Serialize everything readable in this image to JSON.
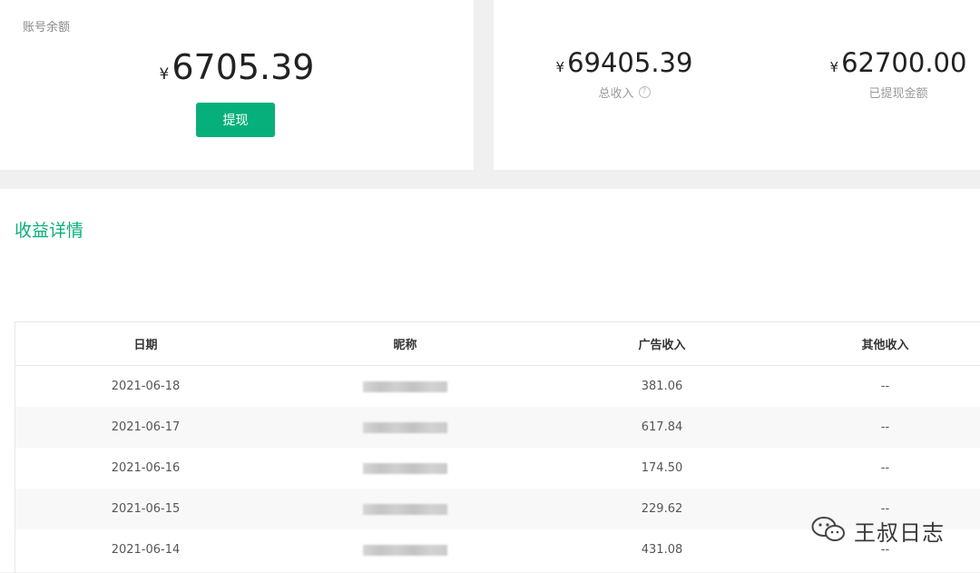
{
  "balance_card": {
    "label": "账号余额",
    "currency": "¥",
    "amount": "6705.39",
    "withdraw_button": "提现"
  },
  "income_card": {
    "total": {
      "currency": "¥",
      "amount": "69405.39",
      "label": "总收入",
      "help": "?"
    },
    "withdrawn": {
      "currency": "¥",
      "amount": "62700.00",
      "label": "已提现金额"
    }
  },
  "details": {
    "title": "收益详情",
    "columns": [
      "日期",
      "昵称",
      "广告收入",
      "其他收入"
    ],
    "rows": [
      {
        "date": "2021-06-18",
        "ad_income": "381.06",
        "other_income": "--"
      },
      {
        "date": "2021-06-17",
        "ad_income": "617.84",
        "other_income": "--"
      },
      {
        "date": "2021-06-16",
        "ad_income": "174.50",
        "other_income": "--"
      },
      {
        "date": "2021-06-15",
        "ad_income": "229.62",
        "other_income": "--"
      },
      {
        "date": "2021-06-14",
        "ad_income": "431.08",
        "other_income": "--"
      }
    ]
  },
  "watermark": {
    "text": "王叔日志"
  }
}
